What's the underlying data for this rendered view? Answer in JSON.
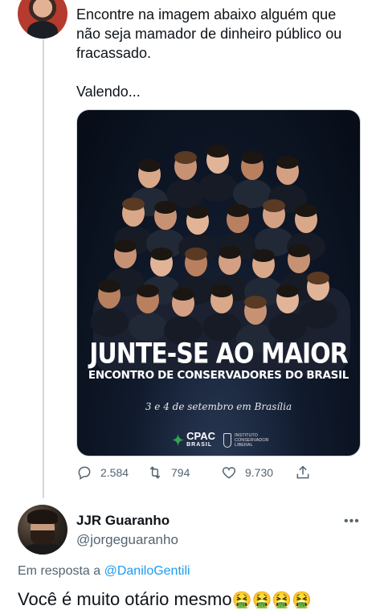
{
  "tweet": {
    "lines": [
      "Encontre na imagem abaixo alguém que",
      "não seja mamador de dinheiro público ou",
      "fracassado.",
      "Valendo..."
    ],
    "media": {
      "headline": "JUNTE-SE AO MAIOR",
      "subline": "ENCONTRO DE CONSERVADORES DO BRASIL",
      "dateline": "3 e 4 de setembro em Brasília",
      "logo_cpac": "CPAC",
      "logo_cpac_sub": "BRASIL",
      "logo_icl": "INSTITUTO CONSERVADOR LIBERAL"
    },
    "actions": {
      "replies": "2.584",
      "retweets": "794",
      "likes": "9.730"
    }
  },
  "reply": {
    "name": "JJR Guaranho",
    "handle": "@jorgeguaranho",
    "reply_prefix": "Em resposta a",
    "reply_mention": "@DaniloGentili",
    "text": "Você é muito otário mesmo",
    "emojis": "🤮🤮🤮🤮"
  }
}
